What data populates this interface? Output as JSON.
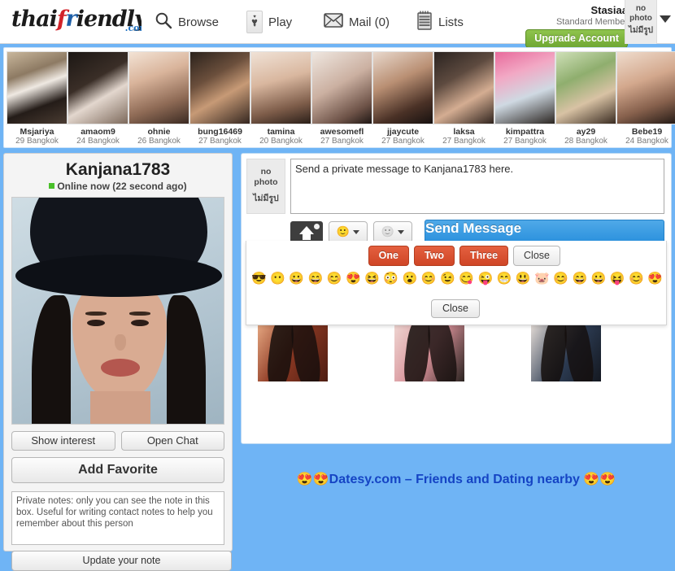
{
  "header": {
    "logo": {
      "part1": "thai",
      "f": "f",
      "r": "r",
      "part2": "iendly",
      "tld": ".com"
    },
    "nav": [
      {
        "label": "Browse",
        "icon": "search-icon"
      },
      {
        "label": "Play",
        "icon": "heart-card-icon"
      },
      {
        "label": "Mail (0)",
        "icon": "envelope-icon"
      },
      {
        "label": "Lists",
        "icon": "notepad-icon"
      }
    ],
    "account": {
      "name": "Stasiaa",
      "membership": "Standard Member",
      "upgrade_label": "Upgrade Account",
      "no_photo_line1": "no",
      "no_photo_line2": "photo",
      "no_photo_thai": "ไม่มีรูป"
    }
  },
  "thumbnails": [
    {
      "name": "Msjariya",
      "meta": "29 Bangkok"
    },
    {
      "name": "amaom9",
      "meta": "24 Bangkok"
    },
    {
      "name": "ohnie",
      "meta": "26 Bangkok"
    },
    {
      "name": "bung16469",
      "meta": "27 Bangkok"
    },
    {
      "name": "tamina",
      "meta": "20 Bangkok"
    },
    {
      "name": "awesomefl",
      "meta": "27 Bangkok"
    },
    {
      "name": "jjaycute",
      "meta": "27 Bangkok"
    },
    {
      "name": "laksa",
      "meta": "27 Bangkok"
    },
    {
      "name": "kimpattra",
      "meta": "27 Bangkok"
    },
    {
      "name": "ay29",
      "meta": "28 Bangkok"
    },
    {
      "name": "Bebe19",
      "meta": "24 Bangkok"
    }
  ],
  "profile": {
    "username": "Kanjana1783",
    "status": "Online now (22 second ago)",
    "show_interest_label": "Show interest",
    "open_chat_label": "Open Chat",
    "add_favorite_label": "Add Favorite",
    "note_value": "Private notes: only you can see the note in this box. Useful for writing contact notes to help you remember about this person",
    "update_note_label": "Update your note"
  },
  "compose": {
    "no_photo_line1": "no",
    "no_photo_line2": "photo",
    "no_photo_thai": "ไม่มีรูป",
    "message_value": "Send a private message to Kanjana1783 here.",
    "send_label": "Send Message",
    "upload_icon": "camera-upload-icon",
    "emoji_icon": "smiley-icon",
    "sticker_icon": "sticker-icon"
  },
  "emoji_popup": {
    "tabs": [
      {
        "label": "One",
        "active": true
      },
      {
        "label": "Two",
        "active": true
      },
      {
        "label": "Three",
        "active": true
      },
      {
        "label": "Close",
        "active": false
      }
    ],
    "emojis": [
      "😎",
      "😶",
      "😀",
      "😄",
      "😊",
      "😍",
      "😆",
      "😳",
      "😮",
      "😊",
      "😉",
      "😋",
      "😜",
      "😁",
      "😃",
      "🐷",
      "😊",
      "😄",
      "😀",
      "😝",
      "😊",
      "😍"
    ],
    "close_label": "Close"
  },
  "banner": {
    "text": "😍😍Datesy.com – Friends and Dating nearby 😍😍"
  },
  "colors": {
    "page_background": "#6fb4f5",
    "send_button": "#2a90dd",
    "upgrade_button": "#6fa733",
    "tab_active": "#cf4526",
    "online_dot": "#49c02a",
    "banner_text": "#1544c4"
  }
}
